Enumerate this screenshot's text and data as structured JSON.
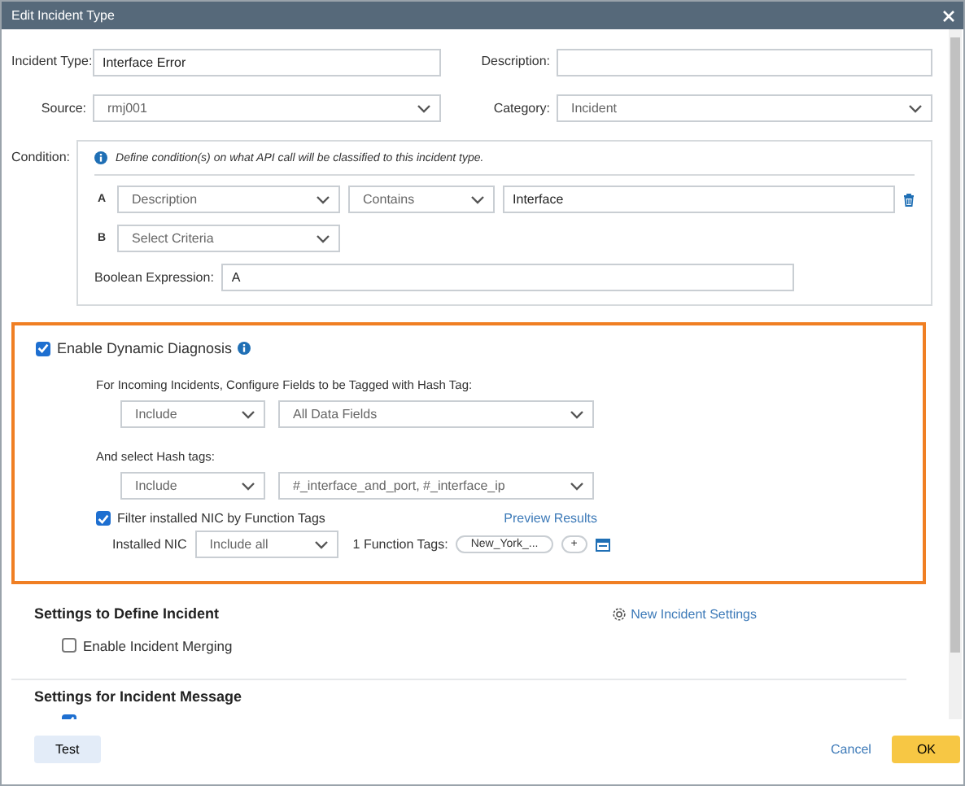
{
  "window": {
    "title": "Edit Incident Type"
  },
  "fields": [
    {
      "label": "Incident Type:",
      "kind": "text",
      "value": "Interface Error"
    },
    {
      "label": "Description:",
      "kind": "text"
    },
    {
      "label": "Source:",
      "kind": "select",
      "value": "rmj001"
    },
    {
      "label": "Category:",
      "kind": "select",
      "value": "Incident"
    }
  ],
  "condition": {
    "label": "Condition:",
    "hint": "Define condition(s) on what API call will be classified to this incident type.",
    "criteria": [
      {
        "letter": "A",
        "field": "Description",
        "operator": "Contains",
        "value": "Interface"
      },
      {
        "letter": "B",
        "field": "Select Criteria"
      }
    ],
    "boolean_label": "Boolean Expression:",
    "boolean_value": "A"
  },
  "dynamic_diagnosis": {
    "label": "Enable Dynamic Diagnosis",
    "checked": true,
    "fields_label": "For Incoming Incidents, Configure Fields to be Tagged with Hash Tag:",
    "fields_mode": "Include",
    "fields_value": "All Data Fields",
    "hash_label": "And select Hash tags:",
    "hash_mode": "Include",
    "hash_value": "#_interface_and_port, #_interface_ip",
    "filter": {
      "label": "Filter installed NIC by Function Tags",
      "checked": true
    },
    "preview_link": "Preview Results",
    "nic_label": "Installed NIC",
    "nic_value": "Include all",
    "tags_label": "1 Function Tags:",
    "tags": [
      "New_York_..."
    ],
    "add": "+"
  },
  "define_incident": {
    "title": "Settings to Define Incident",
    "link": "New Incident Settings",
    "merging": {
      "label": "Enable Incident Merging",
      "checked": false
    }
  },
  "incident_message": {
    "title": "Settings for Incident Message",
    "option_checked": true
  },
  "buttons": {
    "test": "Test",
    "cancel": "Cancel",
    "ok": "OK"
  }
}
